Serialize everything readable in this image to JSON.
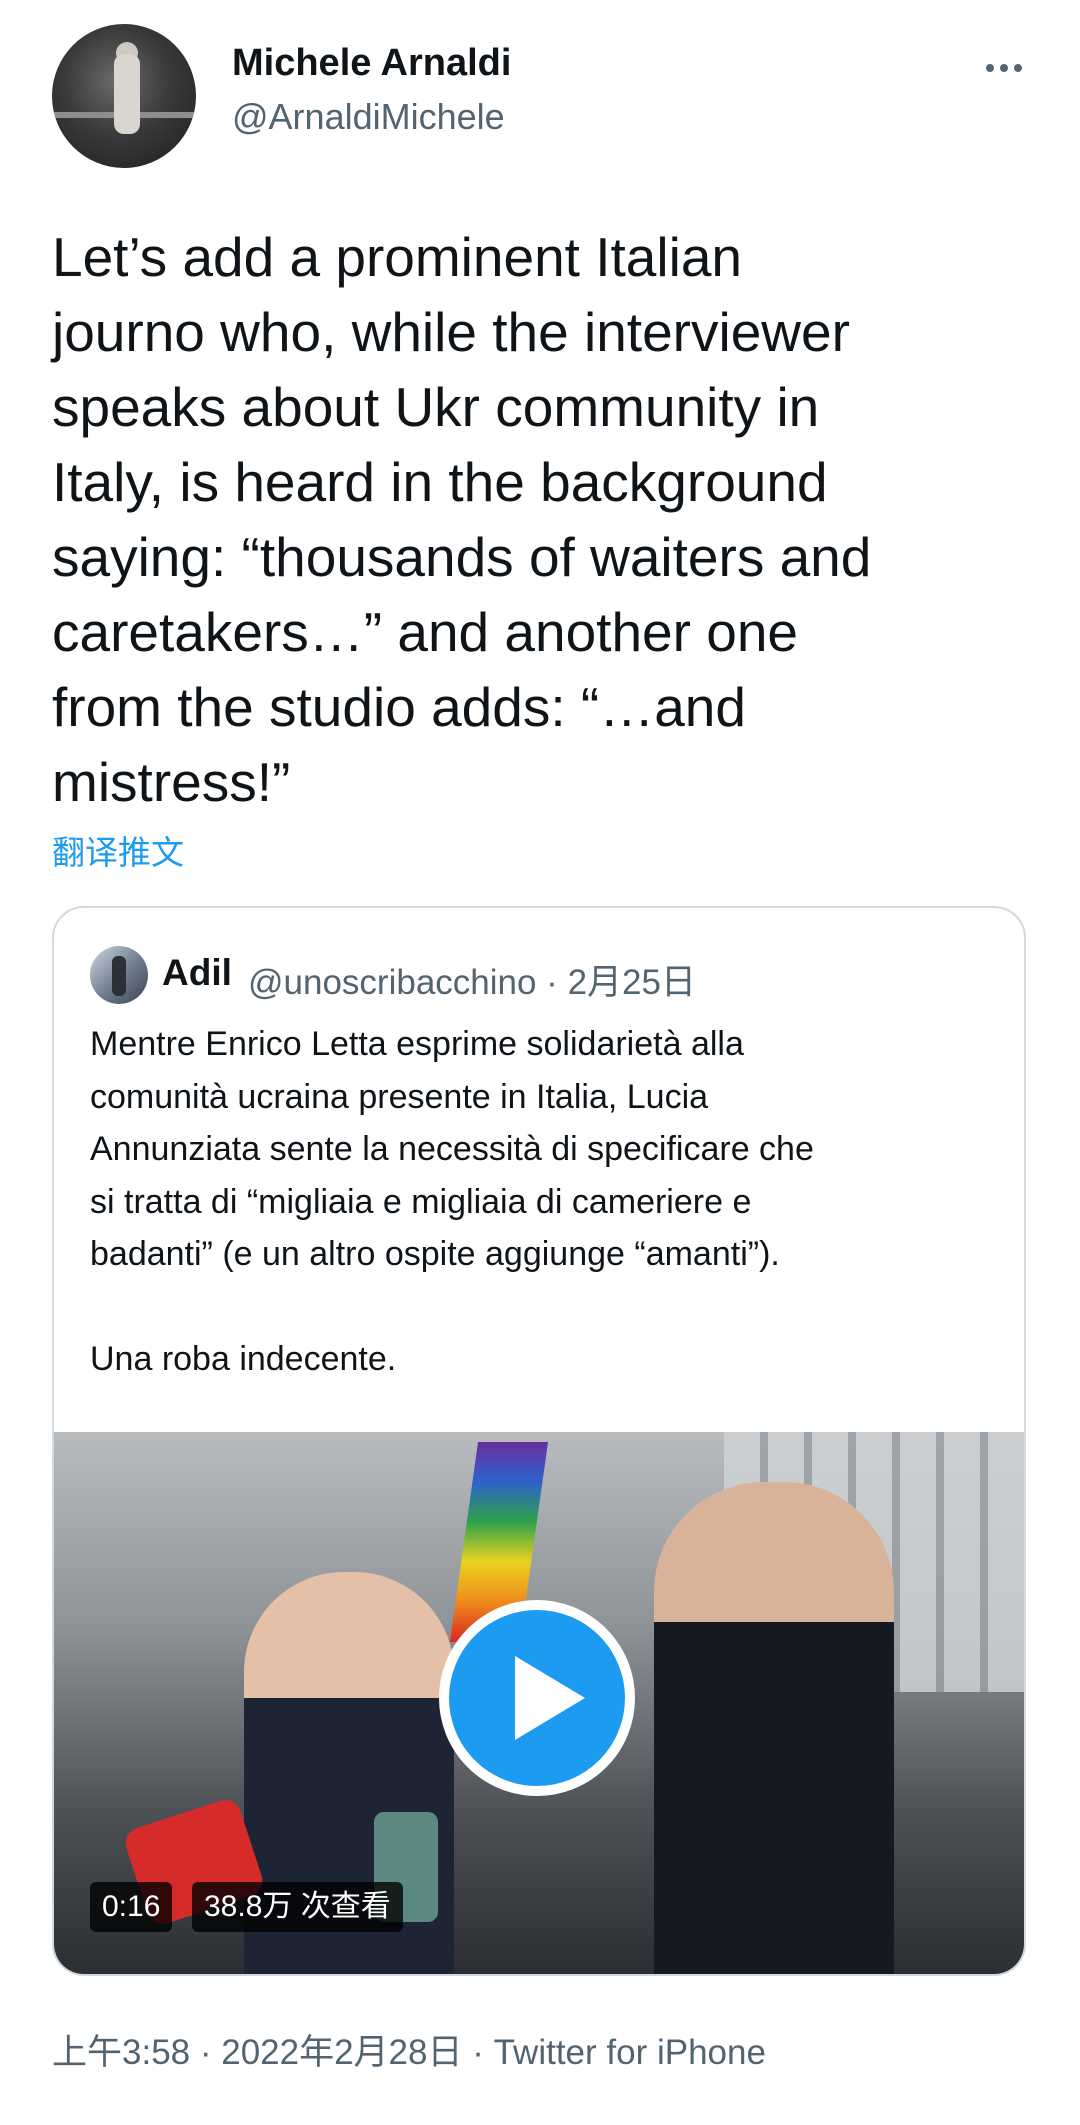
{
  "author": {
    "display_name": "Michele Arnaldi",
    "handle": "@ArnaldiMichele"
  },
  "tweet": {
    "text": "Let’s add a prominent Italian\njourno who, while the interviewer\nspeaks about Ukr community in\nItaly, is heard in the background\nsaying: “thousands of waiters and\ncaretakers…” and another one\nfrom the studio adds: “…and\nmistress!”",
    "translate_label": "翻译推文"
  },
  "quoted_tweet": {
    "name": "Adil",
    "meta": "@unoscribacchino · 2月25日",
    "text": "Mentre Enrico Letta esprime solidarietà alla\ncomunità ucraina presente in Italia, Lucia\nAnnunziata sente la necessità di specificare che\nsi tratta di “migliaia e migliaia di cameriere e\nbadanti” (e un altro ospite aggiunge “amanti”).\n\nUna roba indecente.",
    "video": {
      "duration": "0:16",
      "views": "38.8万 次查看"
    }
  },
  "footer": {
    "timestamp": "上午3:58 · 2022年2月28日",
    "separator": " · ",
    "source": "Twitter for iPhone"
  },
  "colors": {
    "accent": "#1d9bf0",
    "secondary_text": "#536471",
    "primary_text": "#0f1419",
    "border": "#cfd9de"
  },
  "icons": {
    "more": "more-horizontal-icon",
    "play": "play-icon"
  }
}
